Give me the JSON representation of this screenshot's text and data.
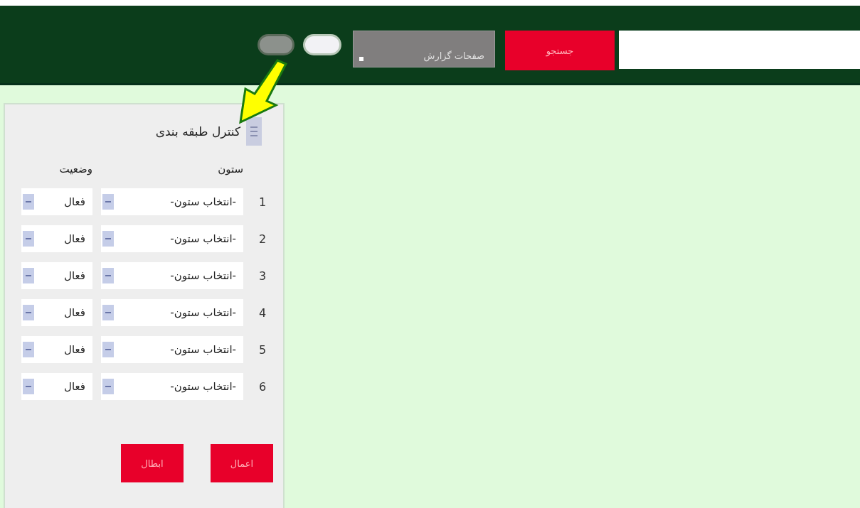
{
  "top_bar": {
    "search_button": "جستجو",
    "report_pages": {
      "label": "صفحات گزارش"
    }
  },
  "panel": {
    "title": "کنترل طبقه بندی",
    "headers": [
      "ستون",
      "وضعیت"
    ],
    "rows": [
      {
        "number": "1",
        "column": "-انتخاب ستون-",
        "status": "فعال"
      },
      {
        "number": "2",
        "column": "-انتخاب ستون-",
        "status": "فعال"
      },
      {
        "number": "3",
        "column": "-انتخاب ستون-",
        "status": "فعال"
      },
      {
        "number": "4",
        "column": "-انتخاب ستون-",
        "status": "فعال"
      },
      {
        "number": "5",
        "column": "-انتخاب ستون-",
        "status": "فعال"
      },
      {
        "number": "6",
        "column": "-انتخاب ستون-",
        "status": "فعال"
      }
    ],
    "buttons": [
      "اعمال",
      "ابطال"
    ]
  }
}
